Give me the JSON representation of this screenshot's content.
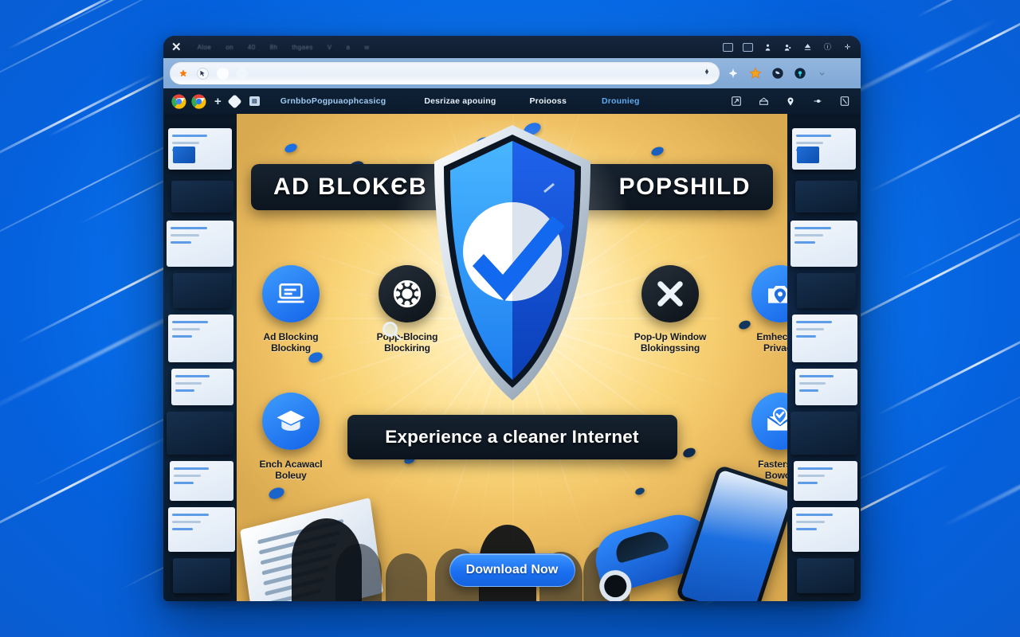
{
  "window": {
    "close_icon": "close-x-icon",
    "menu_items": [
      "Aloe",
      "on",
      "40",
      "8h",
      "thgaes",
      "V",
      "a",
      "w"
    ],
    "titlebar_icons": [
      "window-restore-icon",
      "window-minimize-icon",
      "person-icon",
      "profile-icon",
      "upload-icon",
      "info-icon",
      "add-icon"
    ]
  },
  "omnibox": {
    "value": "",
    "placeholder": "",
    "left_icons": [
      "star-orange-icon",
      "cursor-badge-icon",
      "circle-icon",
      "diamond-icon"
    ],
    "bookmark_icon": "bookmark-outline-icon",
    "right_icons": [
      "sparkle-icon",
      "star-icon",
      "extension-icon",
      "profile-avatar-icon",
      "chevron-down-icon"
    ]
  },
  "bookmarks_bar": {
    "chrome_logo_1": "chrome-logo-icon",
    "chrome_logo_2": "chrome-logo-icon",
    "new_tab_label": "+",
    "diamond_icon": "diamond-icon",
    "square_icon": "image-icon",
    "items": [
      {
        "label": "GrnbboPogpuaophcasicg",
        "color": "#9ec9f2"
      },
      {
        "label": "Desrizae apouing",
        "color": "#e4edf8"
      },
      {
        "label": "Proiooss",
        "color": "#eef4fb"
      },
      {
        "label": "Drounieg",
        "color": "#5ea9ef"
      }
    ],
    "trailing_icons": [
      "expand-icon",
      "inbox-icon",
      "location-pin-icon",
      "slider-icon",
      "bookmark-off-icon"
    ]
  },
  "page": {
    "headline_left": "AD BLOKЄB",
    "headline_right": "POPSHILD",
    "tagline": "Experience a cleaner  Internet",
    "cta_label": "Download Now",
    "shield_icon": "shield-check-icon",
    "features": [
      {
        "id": "ad-blocking",
        "label": "Ad Blocking\nBlocking",
        "icon": "laptop-block-icon",
        "style": "blue"
      },
      {
        "id": "popup-blocking",
        "label": "Popp-Blocing\nBlockiring",
        "icon": "gear-dots-icon",
        "style": "dark"
      },
      {
        "id": "popup-window",
        "label": "Pop-Up Window\nBlokingssing",
        "icon": "cross-block-icon",
        "style": "dark"
      },
      {
        "id": "enhanced-privacy",
        "label": "Emhecced\nPrivacy",
        "icon": "camera-shield-icon",
        "style": "blue"
      },
      {
        "id": "enhanced-policy",
        "label": "Ench Acawacl\nBoleuy",
        "icon": "graduation-cap-icon",
        "style": "blue"
      },
      {
        "id": "faster-browsing",
        "label": "Fastersed\nBowcy",
        "icon": "mail-shield-icon",
        "style": "blue"
      }
    ]
  },
  "colors": {
    "background_blue": "#0a74f0",
    "hero_gold": "#f9d477",
    "accent_blue": "#1a6ff0",
    "banner_dark": "#0c151f",
    "shield_blue": "#1463e8"
  }
}
